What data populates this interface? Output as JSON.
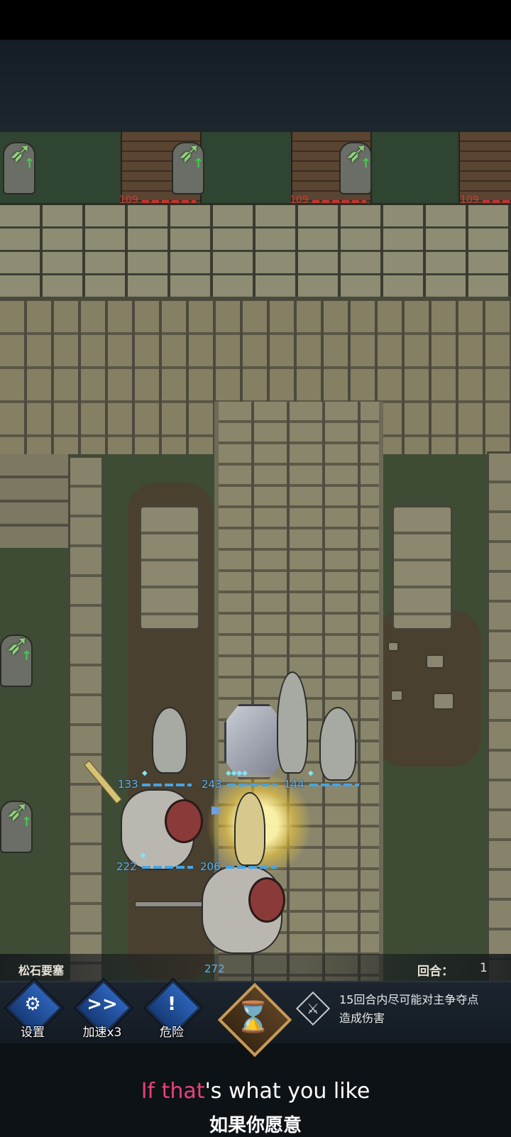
{
  "map": {
    "location_name": "松石要塞",
    "round_label": "回合：",
    "round_value": "1"
  },
  "enemy_hp": [
    "109",
    "109",
    "109"
  ],
  "ally_hp": {
    "knight_left": "133",
    "shield_bearer": "243",
    "lute_soldier": "144",
    "cavalry_left": "222",
    "hero_center": "206",
    "lancer_bottom": "272"
  },
  "controls": {
    "settings": {
      "label": "设置",
      "icon": "gears-icon"
    },
    "speed": {
      "label": "加速x3",
      "glyph": ">>",
      "icon": "fast-forward-icon"
    },
    "danger": {
      "label": "危险",
      "glyph": "!",
      "icon": "exclamation-icon"
    },
    "end_turn": {
      "icon": "hourglass-icon"
    }
  },
  "objective": {
    "icon": "crossed-swords-icon",
    "line1": "15回合内尽可能对主争夺点",
    "line2": "造成伤害"
  },
  "subtitles": {
    "en_highlight": "If that",
    "en_rest": "'s what you like",
    "zh": "如果你愿意"
  },
  "colors": {
    "ally_hp": "#5fb3ec",
    "enemy_hp": "#d23a34",
    "button_blue": "#2c62b8",
    "hourglass_gold": "#f0a23a",
    "subtitle_highlight": "#e8417a"
  }
}
